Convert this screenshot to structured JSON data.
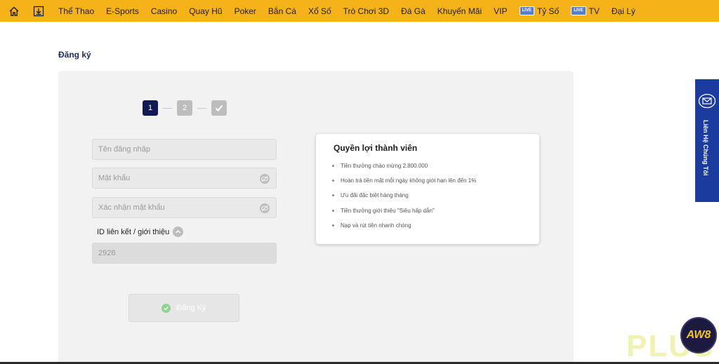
{
  "nav": {
    "items": [
      {
        "label": "Thể Thao"
      },
      {
        "label": "E-Sports"
      },
      {
        "label": "Casino"
      },
      {
        "label": "Quay Hũ"
      },
      {
        "label": "Poker"
      },
      {
        "label": "Bắn Cá"
      },
      {
        "label": "Xổ Số"
      },
      {
        "label": "Trò Chơi 3D"
      },
      {
        "label": "Đá Gà"
      },
      {
        "label": "Khuyến Mãi"
      },
      {
        "label": "VIP"
      },
      {
        "label": "Tỷ Số",
        "badge": "LIVE"
      },
      {
        "label": "TV",
        "badge": "LIVE"
      },
      {
        "label": "Đại Lý"
      }
    ],
    "bg_color": "#f5b219"
  },
  "page": {
    "title": "Đăng ký"
  },
  "stepper": {
    "steps": [
      "1",
      "2"
    ],
    "active_step": 1
  },
  "form": {
    "username_placeholder": "Tên đăng nhập",
    "password_placeholder": "Mật khẩu",
    "confirm_placeholder": "Xác nhận mật khẩu",
    "ref_label": "ID liên kết / giới thiệu",
    "ref_value": "2928",
    "submit_label": "Đăng Ký"
  },
  "benefits": {
    "title": "Quyền lợi thành viên",
    "items": [
      "Tiền thưởng chào mừng 2.800.000",
      "Hoàn trả tiền mặt mỗi ngày không giới hạn lên đến 1%",
      "Ưu đãi đặc biệt hàng tháng",
      "Tiền thưởng giới thiệu \"Siêu hấp dẫn\"",
      "Nạp và rút tiền nhanh chóng"
    ]
  },
  "contact": {
    "label": "Liên Hệ Chúng Tôi",
    "color": "#1b3b9e"
  },
  "brand": {
    "logo_text": "AW8",
    "watermark": "PLUS"
  }
}
